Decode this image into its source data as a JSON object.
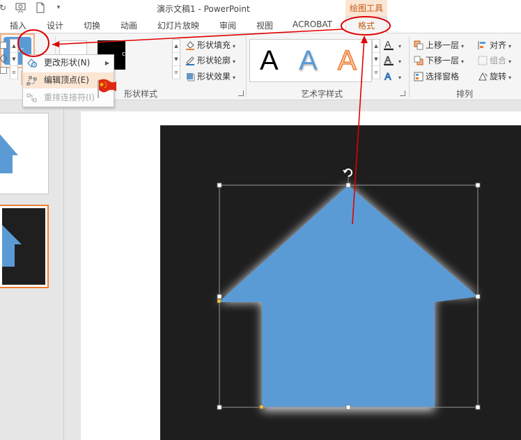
{
  "window": {
    "title": "演示文稿1 - PowerPoint",
    "tools_label": "绘图工具"
  },
  "tabs": [
    {
      "label": "插入"
    },
    {
      "label": "设计"
    },
    {
      "label": "切换"
    },
    {
      "label": "动画"
    },
    {
      "label": "幻灯片放映"
    },
    {
      "label": "审阅"
    },
    {
      "label": "视图"
    },
    {
      "label": "ACROBAT"
    },
    {
      "label": "格式"
    }
  ],
  "ribbon": {
    "shape_styles": {
      "group_label": "形状样式",
      "swatch_text": "Abc",
      "fill": "形状填充",
      "outline": "形状轮廓",
      "effects": "形状效果"
    },
    "wordart": {
      "group_label": "艺术字样式",
      "letter": "A"
    },
    "arrange": {
      "group_label": "排列",
      "bring_forward": "上移一层",
      "send_backward": "下移一层",
      "selection_pane": "选择窗格",
      "align": "对齐",
      "group": "组合",
      "rotate": "旋转"
    }
  },
  "edit_shape_menu": {
    "items": [
      {
        "label": "更改形状(N)",
        "state": "normal"
      },
      {
        "label": "编辑顶点(E)",
        "state": "highlighted"
      },
      {
        "label": "重排连接符(I)",
        "state": "disabled"
      }
    ]
  },
  "colors": {
    "accent": "#c55a11",
    "tab_highlight": "#fbe5d3",
    "shape_fill": "#5b9bd5",
    "annotation": "#e00000",
    "thumb_selected": "#ed7d31",
    "slide_dark": "#1e1e1e"
  },
  "icons": {
    "edit_shape": "edit-shape-icon",
    "change_shape": "change-shape-icon",
    "edit_points": "edit-points-icon",
    "reroute": "reroute-connectors-icon",
    "rotate_handle": "rotate-handle-icon",
    "flag": "china-flag-icon"
  }
}
